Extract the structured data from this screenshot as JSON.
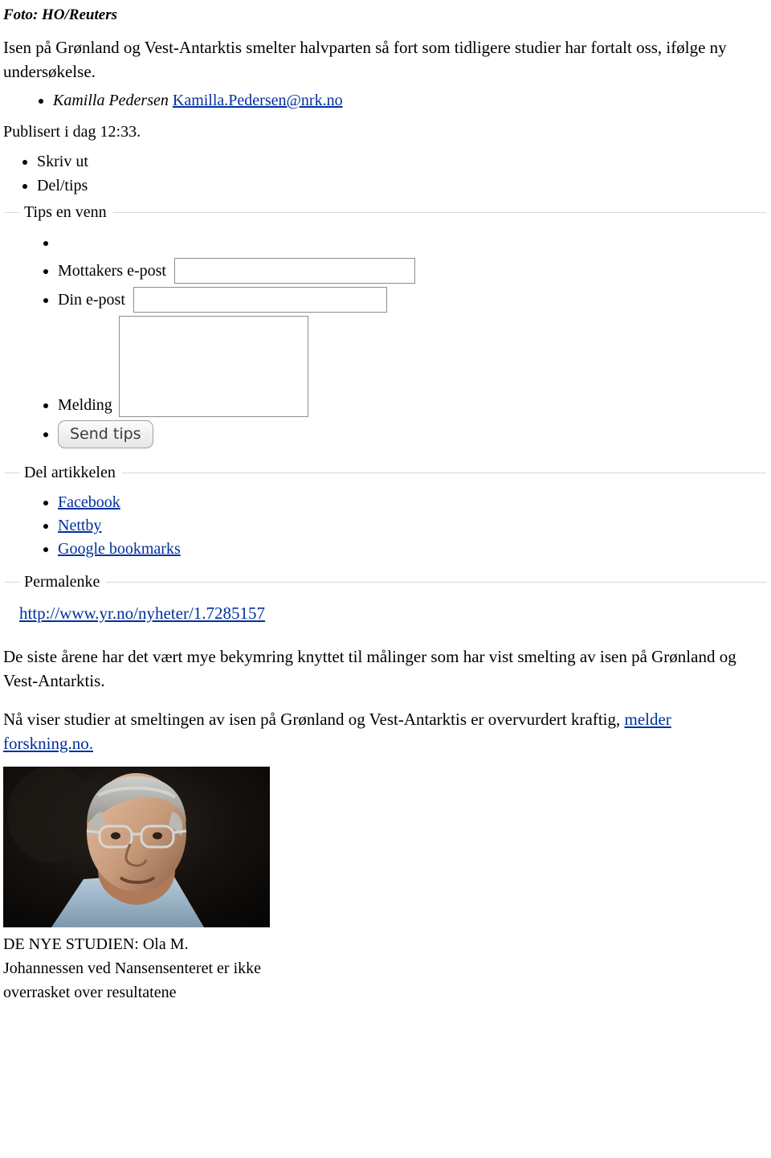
{
  "photo_credit": "Foto: HO/Reuters",
  "lead": "Isen på Grønland og Vest-Antarktis smelter halvparten så fort som tidligere studier har fortalt oss, ifølge ny undersøkelse.",
  "byline": {
    "name": "Kamilla Pedersen",
    "email": "Kamilla.Pedersen@nrk.no"
  },
  "published": "Publisert i dag 12:33.",
  "actions": [
    "Skriv ut",
    "Del/tips"
  ],
  "tips_form": {
    "legend": "Tips en venn",
    "recipient_label": "Mottakers e-post",
    "recipient_value": "",
    "sender_label": "Din e-post",
    "sender_value": "",
    "message_label": "Melding",
    "message_value": "",
    "send_label": "Send tips"
  },
  "share": {
    "legend": "Del artikkelen",
    "links": [
      "Facebook",
      "Nettby",
      "Google bookmarks"
    ]
  },
  "permalink": {
    "legend": "Permalenke",
    "url": "http://www.yr.no/nyheter/1.7285157"
  },
  "body": {
    "paragraph_1": "De siste årene har det vært mye bekymring knyttet til målinger som har vist smelting av isen på Grønland og Vest-Antarktis.",
    "paragraph_2_prefix": "Nå viser studier at smeltingen av isen på Grønland og Vest-Antarktis er overvurdert kraftig, ",
    "paragraph_2_link_1": "melder",
    "paragraph_2_link_2": "forskning.no."
  },
  "photo_caption": "DE NYE STUDIEN: Ola M. Johannessen ved Nansensenteret er ikke overrasket over resultatene",
  "colors": {
    "link": "#00309e",
    "text": "#000000",
    "field_border": "#8d8d8d",
    "group_border": "#d8d8d8"
  }
}
